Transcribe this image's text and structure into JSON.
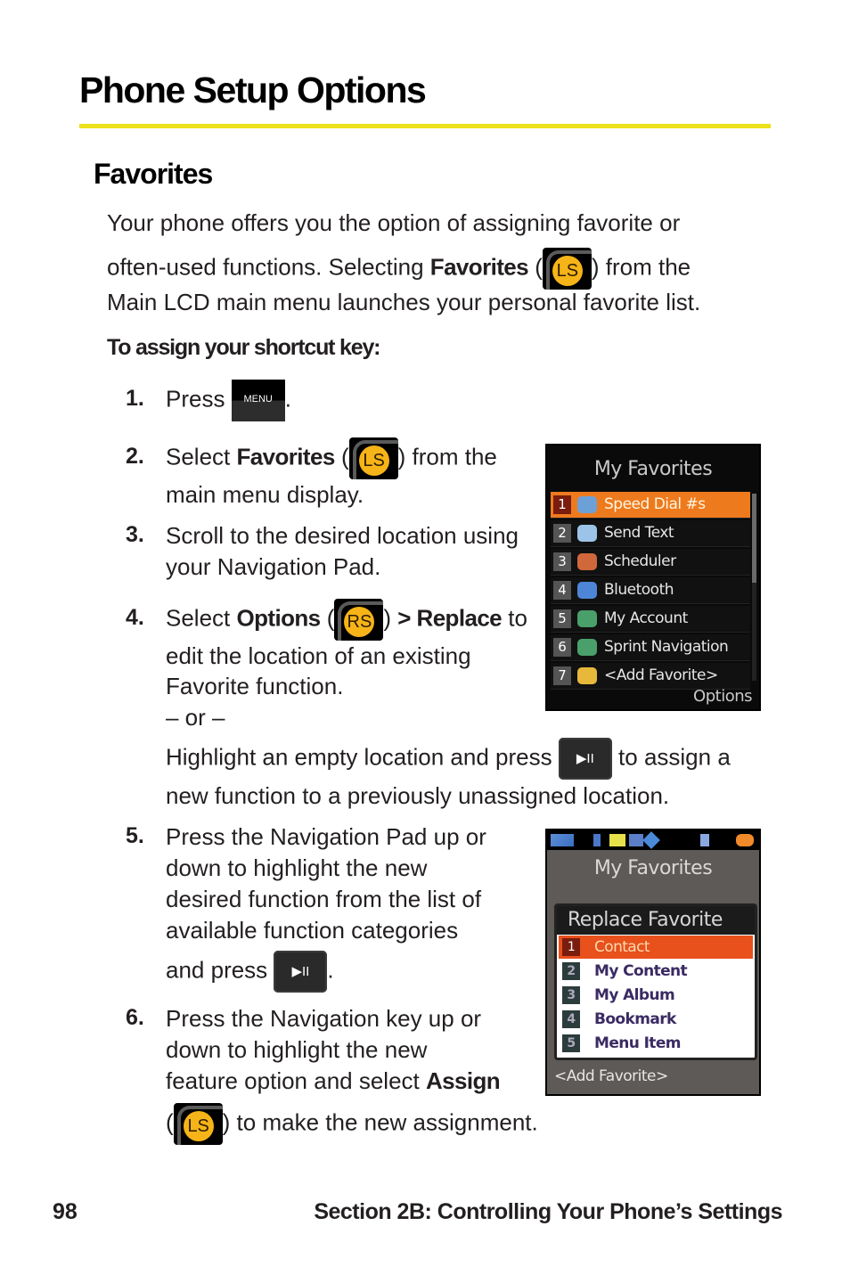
{
  "page": {
    "title": "Phone Setup Options",
    "section": "Favorites",
    "intro": {
      "line1": "Your phone offers you the option of assigning favorite or",
      "line2_pre": "often-used functions. Selecting ",
      "line2_bold": "Favorites",
      "line2_open": " (",
      "line2_close": ") from the",
      "line3": "Main LCD main menu launches your personal favorite list."
    },
    "subheading": "To assign your shortcut key:",
    "steps": [
      {
        "num": "1.",
        "pre": "Press ",
        "post": "."
      },
      {
        "num": "2.",
        "pre": "Select ",
        "bold": "Favorites",
        "open": " (",
        "close": ") from the",
        "line2": "main menu display."
      },
      {
        "num": "3.",
        "line1": "Scroll to the desired location using",
        "line2": "your Navigation Pad."
      },
      {
        "num": "4.",
        "pre": "Select ",
        "bold": "Options",
        "open": " (",
        "close": ") ",
        "arrow": "> ",
        "bold2": "Replace",
        "post": " to",
        "line2": "edit the location of an existing",
        "line3": "Favorite function.",
        "or": "– or –",
        "alt1_pre": "Highlight an empty location and press ",
        "alt1_post": " to assign a",
        "alt2": "new function to a previously unassigned location."
      },
      {
        "num": "5.",
        "line1": "Press the Navigation Pad up or",
        "line2": "down to highlight the new",
        "line3": "desired function from the list of",
        "line4": "available function categories",
        "line5_pre": "and press ",
        "line5_post": "."
      },
      {
        "num": "6.",
        "line1": "Press the Navigation key up or",
        "line2": "down to highlight the new",
        "line3_pre": "feature option and select ",
        "line3_bold": "Assign",
        "line4_open": "(",
        "line4_close": ") to make the new assignment."
      }
    ],
    "keys": {
      "menu": "MENU",
      "left_soft": "LS",
      "right_soft": "RS",
      "play_pause": "▶II"
    }
  },
  "screen1": {
    "title": "My Favorites",
    "items": [
      {
        "num": "1",
        "label": "Speed Dial #s",
        "icon": "speed-dial-icon",
        "color": "#6ea0d8",
        "selected": true
      },
      {
        "num": "2",
        "label": "Send Text",
        "icon": "send-text-icon",
        "color": "#9cc4e8"
      },
      {
        "num": "3",
        "label": "Scheduler",
        "icon": "scheduler-icon",
        "color": "#d0683c"
      },
      {
        "num": "4",
        "label": "Bluetooth",
        "icon": "bluetooth-icon",
        "color": "#4d86d6"
      },
      {
        "num": "5",
        "label": "My Account",
        "icon": "my-account-icon",
        "color": "#4aa06a"
      },
      {
        "num": "6",
        "label": "Sprint Navigation",
        "icon": "sprint-navigation-icon",
        "color": "#4aa06a"
      },
      {
        "num": "7",
        "label": "<Add Favorite>",
        "icon": "add-favorite-icon",
        "color": "#e8b83a"
      }
    ],
    "softkey": "Options"
  },
  "screen2": {
    "title": "My Favorites",
    "popup_title": "Replace Favorite",
    "items": [
      {
        "num": "1",
        "label": "Contact",
        "selected": true
      },
      {
        "num": "2",
        "label": "My Content"
      },
      {
        "num": "3",
        "label": "My Album"
      },
      {
        "num": "4",
        "label": "Bookmark"
      },
      {
        "num": "5",
        "label": "Menu Item"
      }
    ],
    "bottom_item": "<Add Favorite>",
    "status_icons": [
      "signal-icon",
      "music-icon",
      "calendar-icon",
      "message-icon",
      "navigation-icon",
      "memory-card-icon",
      "battery-icon"
    ]
  },
  "footer": {
    "page_number": "98",
    "section": "Section 2B: Controlling Your Phone’s Settings"
  },
  "colors": {
    "accent_rule": "#ede11c",
    "highlight_orange": "#ee7a1e",
    "key_yellow": "#f6b418"
  }
}
